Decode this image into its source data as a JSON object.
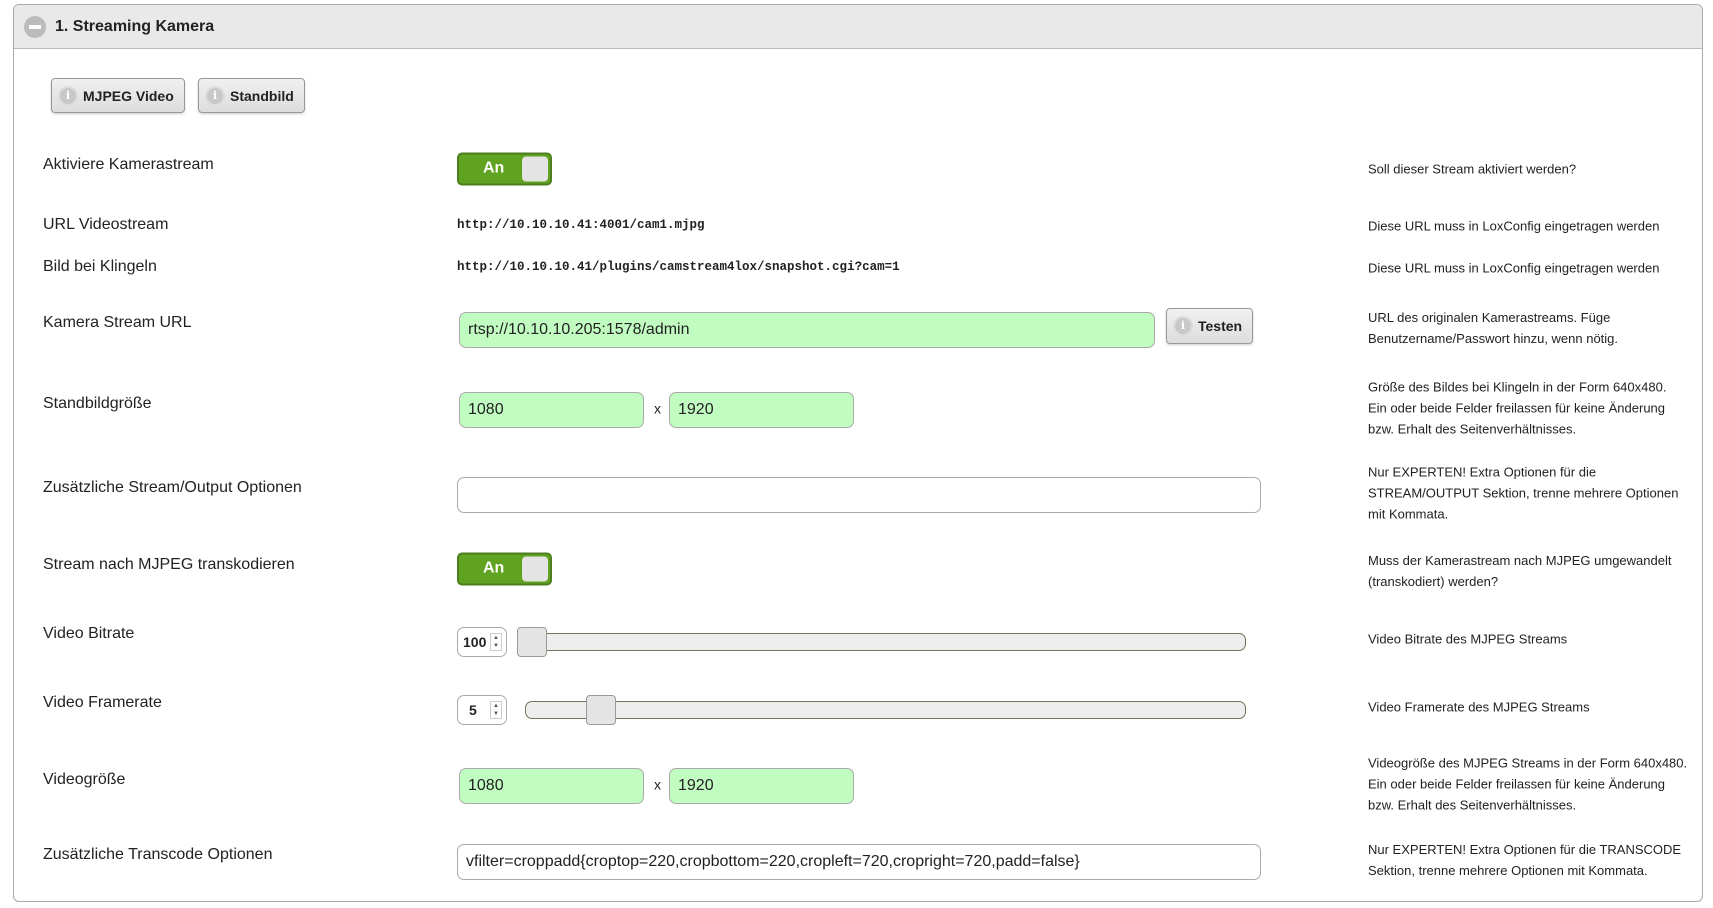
{
  "section": {
    "title": "1. Streaming Kamera"
  },
  "buttons": {
    "mjpeg": "MJPEG Video",
    "standbild": "Standbild",
    "testen": "Testen",
    "info_glyph": "i"
  },
  "rows": {
    "activate": {
      "label": "Aktiviere Kamerastream",
      "toggle": "An",
      "help": "Soll dieser Stream aktiviert werden?"
    },
    "url_video": {
      "label": "URL Videostream",
      "value": "http://10.10.10.41:4001/cam1.mjpg",
      "help": "Diese URL muss in LoxConfig eingetragen werden"
    },
    "bell": {
      "label": "Bild bei Klingeln",
      "value": "http://10.10.10.41/plugins/camstream4lox/snapshot.cgi?cam=1",
      "help": "Diese URL muss in LoxConfig eingetragen werden"
    },
    "cam_url": {
      "label": "Kamera Stream URL",
      "value": "rtsp://10.10.10.205:1578/admin",
      "help": "URL des originalen Kamerastreams. Füge Benutzername/Passwort hinzu, wenn nötig."
    },
    "still_size": {
      "label": "Standbildgröße",
      "width": "1080",
      "sep": "x",
      "height": "1920",
      "help": "Größe des Bildes bei Klingeln in der Form 640x480. Ein oder beide Felder freilassen für keine Änderung bzw. Erhalt des Seitenverhältnisses."
    },
    "stream_opts": {
      "label": "Zusätzliche Stream/Output Optionen",
      "value": "",
      "help": "Nur EXPERTEN! Extra Optionen für die STREAM/OUTPUT Sektion, trenne mehrere Optionen mit Kommata."
    },
    "transcode": {
      "label": "Stream nach MJPEG transkodieren",
      "toggle": "An",
      "help": "Muss der Kamerastream nach MJPEG umgewandelt (transkodiert) werden?"
    },
    "bitrate": {
      "label": "Video Bitrate",
      "value": "100",
      "slider_fraction": 0.0,
      "help": "Video Bitrate des MJPEG Streams"
    },
    "framerate": {
      "label": "Video Framerate",
      "value": "5",
      "slider_fraction": 0.09,
      "help": "Video Framerate des MJPEG Streams"
    },
    "video_size": {
      "label": "Videogröße",
      "width": "1080",
      "sep": "x",
      "height": "1920",
      "help": "Videogröße des MJPEG Streams in der Form 640x480. Ein oder beide Felder freilassen für keine Änderung bzw. Erhalt des Seitenverhältnisses."
    },
    "transcode_opts": {
      "label": "Zusätzliche Transcode Optionen",
      "value": "vfilter=croppadd{croptop=220,cropbottom=220,cropleft=720,cropright=720,padd=false}",
      "help": "Nur EXPERTEN! Extra Optionen für die TRANSCODE Sektion, trenne mehrere Optionen mit Kommata."
    }
  }
}
